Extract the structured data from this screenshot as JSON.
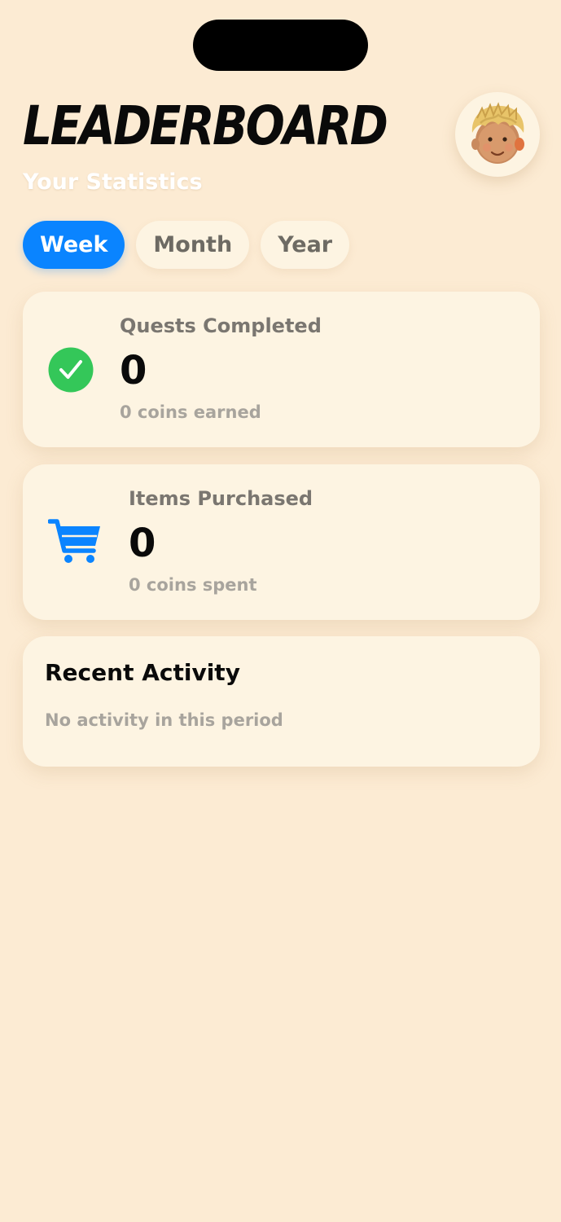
{
  "header": {
    "title": "LEADERBOARD",
    "subtitle": "Your Statistics",
    "avatar_icon": "child-face-avatar-icon"
  },
  "tabs": [
    {
      "label": "Week",
      "active": true
    },
    {
      "label": "Month",
      "active": false
    },
    {
      "label": "Year",
      "active": false
    }
  ],
  "stats": {
    "quests": {
      "label": "Quests Completed",
      "value": "0",
      "sub": "0 coins earned",
      "icon": "checkmark-circle-icon",
      "icon_color": "#34c759"
    },
    "items": {
      "label": "Items Purchased",
      "value": "0",
      "sub": "0 coins spent",
      "icon": "cart-icon",
      "icon_color": "#0a84ff"
    }
  },
  "recent": {
    "title": "Recent Activity",
    "empty_text": "No activity in this period"
  },
  "colors": {
    "background": "#fcebd3",
    "card": "#fdf4e2",
    "accent": "#0a84ff",
    "success": "#34c759"
  }
}
